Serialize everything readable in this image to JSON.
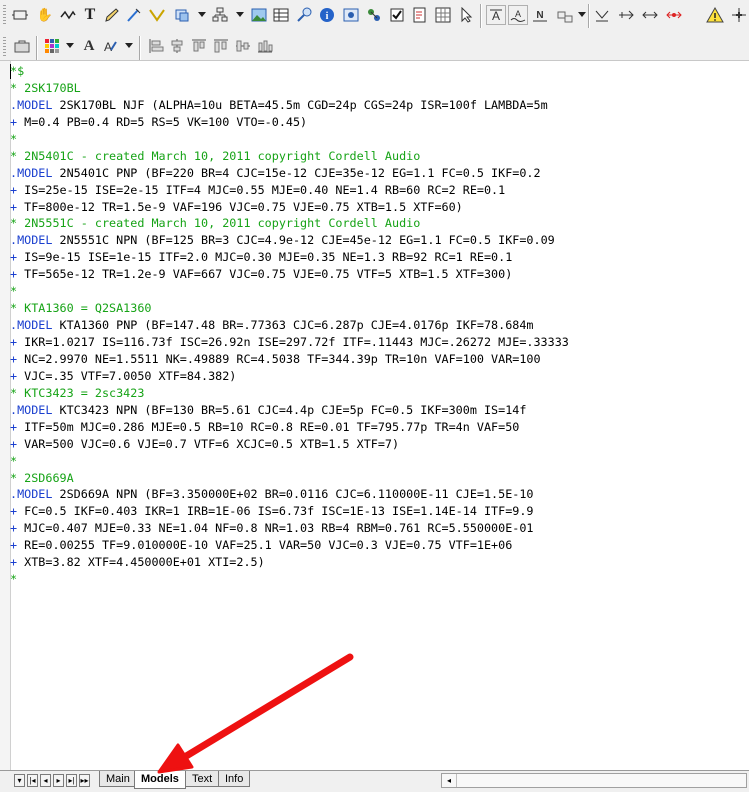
{
  "toolbar1": {
    "icons": [
      "component-icon",
      "hand-pan-icon",
      "wire-icon",
      "text-tool-icon",
      "pencil-icon",
      "pen-icon",
      "bus-icon",
      "shape-icon",
      "image-icon",
      "table-icon",
      "flag-icon",
      "info-icon",
      "window-icon",
      "network-icon",
      "checkbox-icon",
      "edit-list-icon",
      "grid-icon",
      "select-arrow-icon",
      "text-style-a-icon",
      "text-style-wave-icon",
      "text-style-n-icon",
      "diagram-icon",
      "node-icon",
      "bus-arrow-icon",
      "bidir-arrow-icon",
      "red-arrow-icon",
      "warning-icon",
      "crosshair-icon"
    ]
  },
  "toolbar2": {
    "font_label": "A",
    "icons": [
      "toolbox-icon",
      "color-grid-icon",
      "font-icon",
      "text-style-icon",
      "align-left-icon",
      "align-center-icon",
      "align-top-icon",
      "align-middle-icon",
      "distribute-icon"
    ]
  },
  "code_lines": [
    {
      "cls": "cmt",
      "text": "*$"
    },
    {
      "cls": "cmt",
      "text": "* 2SK170BL"
    },
    {
      "cls": "model",
      "kw": ".MODEL",
      "text": " 2SK170BL NJF (ALPHA=10u BETA=45.5m CGD=24p CGS=24p ISR=100f LAMBDA=5m"
    },
    {
      "cls": "plus",
      "kw": "+",
      "text": " M=0.4 PB=0.4 RD=5 RS=5 VK=100 VTO=-0.45)"
    },
    {
      "cls": "cmt",
      "text": "*"
    },
    {
      "cls": "cmt",
      "text": "* 2N5401C - created March 10, 2011 copyright Cordell Audio"
    },
    {
      "cls": "model",
      "kw": ".MODEL",
      "text": " 2N5401C PNP (BF=220 BR=4 CJC=15e-12 CJE=35e-12 EG=1.1 FC=0.5 IKF=0.2"
    },
    {
      "cls": "plus",
      "kw": "+",
      "text": " IS=25e-15 ISE=2e-15 ITF=4 MJC=0.55 MJE=0.40 NE=1.4 RB=60 RC=2 RE=0.1"
    },
    {
      "cls": "plus",
      "kw": "+",
      "text": " TF=800e-12 TR=1.5e-9 VAF=196 VJC=0.75 VJE=0.75 XTB=1.5 XTF=60)"
    },
    {
      "cls": "cmt",
      "text": "* 2N5551C - created March 10, 2011 copyright Cordell Audio"
    },
    {
      "cls": "model",
      "kw": ".MODEL",
      "text": " 2N5551C NPN (BF=125 BR=3 CJC=4.9e-12 CJE=45e-12 EG=1.1 FC=0.5 IKF=0.09"
    },
    {
      "cls": "plus",
      "kw": "+",
      "text": " IS=9e-15 ISE=1e-15 ITF=2.0 MJC=0.30 MJE=0.35 NE=1.3 RB=92 RC=1 RE=0.1"
    },
    {
      "cls": "plus",
      "kw": "+",
      "text": " TF=565e-12 TR=1.2e-9 VAF=667 VJC=0.75 VJE=0.75 VTF=5 XTB=1.5 XTF=300)"
    },
    {
      "cls": "cmt",
      "text": "*"
    },
    {
      "cls": "cmt",
      "text": "* KTA1360 = Q2SA1360"
    },
    {
      "cls": "model",
      "kw": ".MODEL",
      "text": " KTA1360 PNP (BF=147.48 BR=.77363 CJC=6.287p CJE=4.0176p IKF=78.684m"
    },
    {
      "cls": "plus",
      "kw": "+",
      "text": " IKR=1.0217 IS=116.73f ISC=26.92n ISE=297.72f ITF=.11443 MJC=.26272 MJE=.33333"
    },
    {
      "cls": "plus",
      "kw": "+",
      "text": " NC=2.9970 NE=1.5511 NK=.49889 RC=4.5038 TF=344.39p TR=10n VAF=100 VAR=100"
    },
    {
      "cls": "plus",
      "kw": "+",
      "text": " VJC=.35 VTF=7.0050 XTF=84.382)"
    },
    {
      "cls": "cmt",
      "text": "* KTC3423 = 2sc3423"
    },
    {
      "cls": "model",
      "kw": ".MODEL",
      "text": " KTC3423 NPN (BF=130 BR=5.61 CJC=4.4p CJE=5p FC=0.5 IKF=300m IS=14f"
    },
    {
      "cls": "plus",
      "kw": "+",
      "text": " ITF=50m MJC=0.286 MJE=0.5 RB=10 RC=0.8 RE=0.01 TF=795.77p TR=4n VAF=50"
    },
    {
      "cls": "plus",
      "kw": "+",
      "text": " VAR=500 VJC=0.6 VJE=0.7 VTF=6 XCJC=0.5 XTB=1.5 XTF=7)"
    },
    {
      "cls": "cmt",
      "text": "*"
    },
    {
      "cls": "cmt",
      "text": "* 2SD669A"
    },
    {
      "cls": "model",
      "kw": ".MODEL",
      "text": " 2SD669A NPN (BF=3.350000E+02 BR=0.0116 CJC=6.110000E-11 CJE=1.5E-10"
    },
    {
      "cls": "plus",
      "kw": "+",
      "text": " FC=0.5 IKF=0.403 IKR=1 IRB=1E-06 IS=6.73f ISC=1E-13 ISE=1.14E-14 ITF=9.9"
    },
    {
      "cls": "plus",
      "kw": "+",
      "text": " MJC=0.407 MJE=0.33 NE=1.04 NF=0.8 NR=1.03 RB=4 RBM=0.761 RC=5.550000E-01"
    },
    {
      "cls": "plus",
      "kw": "+",
      "text": " RE=0.00255 TF=9.010000E-10 VAF=25.1 VAR=50 VJC=0.3 VJE=0.75 VTF=1E+06"
    },
    {
      "cls": "plus",
      "kw": "+",
      "text": " XTB=3.82 XTF=4.450000E+01 XTI=2.5)"
    },
    {
      "cls": "cmt",
      "text": "*"
    }
  ],
  "bottom": {
    "tabs": [
      {
        "label": "Main",
        "active": false
      },
      {
        "label": "Models",
        "active": true
      },
      {
        "label": "Text",
        "active": false
      },
      {
        "label": "Info",
        "active": false
      }
    ],
    "nav_icons": [
      "first-page-icon",
      "prev-page-icon",
      "next-page-icon",
      "last-page-icon"
    ]
  },
  "colors": {
    "comment": "#16a316",
    "keyword": "#1a3fcf",
    "annotation_arrow": "#ee1111"
  }
}
